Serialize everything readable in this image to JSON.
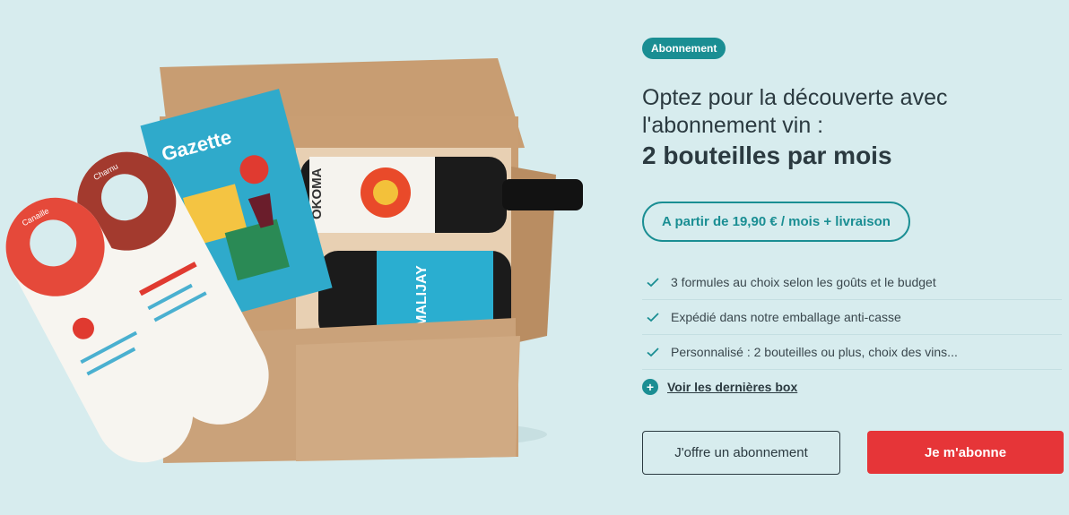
{
  "badge": "Abonnement",
  "headline": {
    "line1": "Optez pour la découverte avec",
    "line2": "l'abonnement vin :",
    "strong": "2 bouteilles par mois"
  },
  "price": "A partir de 19,90 € / mois + livraison",
  "features": [
    "3 formules au choix selon les goûts et le budget",
    "Expédié dans notre emballage anti-casse",
    "Personnalisé : 2 bouteilles ou plus, choix des vins..."
  ],
  "link": "Voir les dernières box",
  "buttons": {
    "gift": "J'offre un abonnement",
    "subscribe": "Je m'abonne"
  },
  "visual": {
    "gazette": "Gazette",
    "okoma": "OKOMA",
    "malijay": "MALIJAY",
    "tag1": "Canaille",
    "tag2": "Charnu"
  },
  "colors": {
    "background": "#d7ecee",
    "accent": "#1a8e93",
    "primary": "#e63538"
  }
}
